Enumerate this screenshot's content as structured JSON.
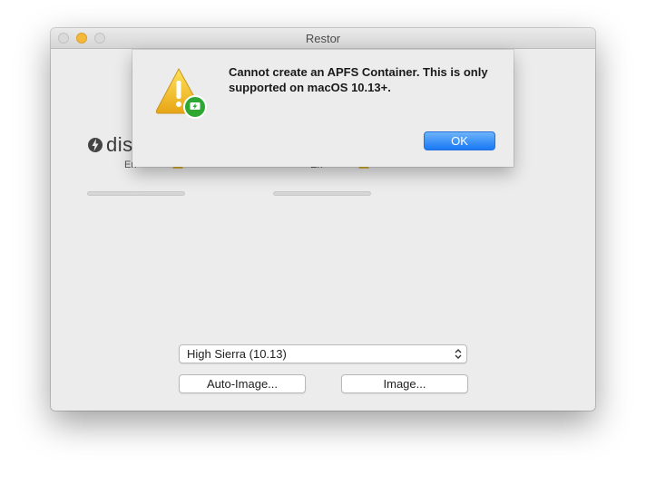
{
  "window": {
    "title": "Restor"
  },
  "main": {
    "brand_text": "dis",
    "left_label": "Err",
    "right_label": "Err",
    "os_select": {
      "selected": "High Sierra (10.13)"
    },
    "buttons": {
      "auto_image": "Auto-Image...",
      "image": "Image..."
    }
  },
  "alert": {
    "message": "Cannot create an APFS Container. This is only supported on macOS 10.13+.",
    "ok_label": "OK",
    "icon": "warning-icon"
  },
  "colors": {
    "accent": "#1978f5",
    "warning": "#f5c62b",
    "badge": "#2fa833"
  }
}
